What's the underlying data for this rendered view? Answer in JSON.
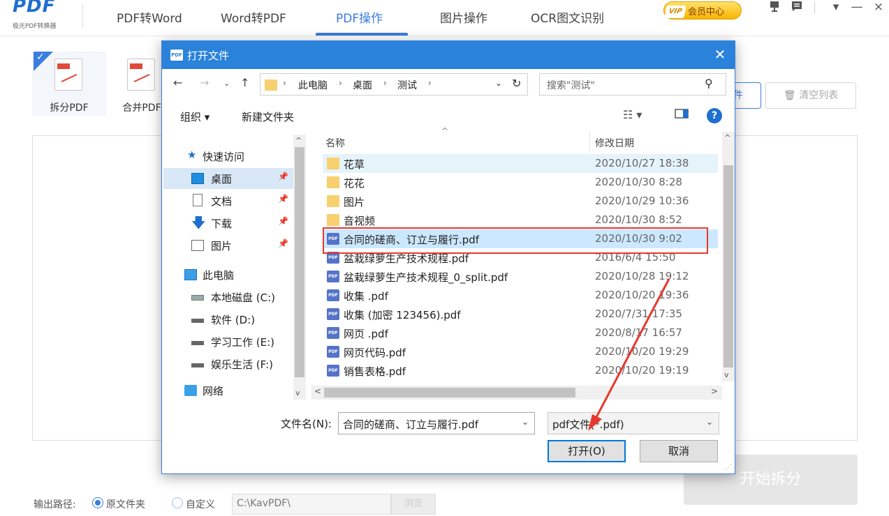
{
  "app": {
    "logo": "PDF",
    "logo_sub": "极光PDF转换器",
    "nav": [
      "PDF转Word",
      "Word转PDF",
      "PDF操作",
      "图片操作",
      "OCR图文识别"
    ],
    "vip_tag": "VIP",
    "vip_label": "会员中心",
    "win_min": "—",
    "win_close": "×",
    "win_menu": "▾"
  },
  "tools": [
    {
      "label": "拆分PDF"
    },
    {
      "label": "合并PDF"
    }
  ],
  "right_buttons": {
    "add": "件",
    "clear": "清空列表",
    "clear_icon": "🗑"
  },
  "start_button": "开始拆分",
  "output": {
    "label": "输出路径:",
    "option_original": "原文件夹",
    "option_custom": "自定义",
    "path": "C:\\KavPDF\\",
    "browse": "浏览"
  },
  "dialog": {
    "title": "打开文件",
    "title_icon": "PDF",
    "close": "✕",
    "address": {
      "crumbs": [
        "此电脑",
        "桌面",
        "测试"
      ],
      "search_placeholder": "搜索\"测试\""
    },
    "commands": {
      "organize": "组织 ▾",
      "new_folder": "新建文件夹"
    },
    "nav_pane": [
      {
        "label": "快速访问",
        "icon": "star-icon",
        "pinned": false
      },
      {
        "label": "桌面",
        "icon": "desktop-icon",
        "pinned": true
      },
      {
        "label": "文档",
        "icon": "document-icon",
        "pinned": true
      },
      {
        "label": "下载",
        "icon": "download-icon",
        "pinned": true
      },
      {
        "label": "图片",
        "icon": "pictures-icon",
        "pinned": true
      },
      {
        "label": "此电脑",
        "icon": "computer-icon",
        "pinned": false
      },
      {
        "label": "本地磁盘 (C:)",
        "icon": "drive-icon",
        "pinned": false
      },
      {
        "label": "软件 (D:)",
        "icon": "drive-icon",
        "pinned": false
      },
      {
        "label": "学习工作 (E:)",
        "icon": "drive-icon",
        "pinned": false
      },
      {
        "label": "娱乐生活 (F:)",
        "icon": "drive-icon",
        "pinned": false
      },
      {
        "label": "网络",
        "icon": "network-icon",
        "pinned": false
      }
    ],
    "columns": {
      "name": "名称",
      "date": "修改日期"
    },
    "files": [
      {
        "name": "花草",
        "date": "2020/10/27 18:38",
        "type": "folder"
      },
      {
        "name": "花花",
        "date": "2020/10/30 8:28",
        "type": "folder"
      },
      {
        "name": "图片",
        "date": "2020/10/29 10:36",
        "type": "folder"
      },
      {
        "name": "音视频",
        "date": "2020/10/30 8:52",
        "type": "folder"
      },
      {
        "name": "合同的磋商、订立与履行.pdf",
        "date": "2020/10/30 9:02",
        "type": "pdf"
      },
      {
        "name": "盆栽绿萝生产技术规程.pdf",
        "date": "2016/6/4 15:50",
        "type": "pdf"
      },
      {
        "name": "盆栽绿萝生产技术规程_0_split.pdf",
        "date": "2020/10/28 19:12",
        "type": "pdf"
      },
      {
        "name": "收集 .pdf",
        "date": "2020/10/20 19:36",
        "type": "pdf"
      },
      {
        "name": "收集 (加密 123456).pdf",
        "date": "2020/7/31 17:35",
        "type": "pdf"
      },
      {
        "name": "网页 .pdf",
        "date": "2020/8/17 16:57",
        "type": "pdf"
      },
      {
        "name": "网页代码.pdf",
        "date": "2020/10/20 19:29",
        "type": "pdf"
      },
      {
        "name": "销售表格.pdf",
        "date": "2020/10/20 19:19",
        "type": "pdf"
      }
    ],
    "filename_label": "文件名(N):",
    "filename_value": "合同的磋商、订立与履行.pdf",
    "filetype_value": "pdf文件(*.pdf)",
    "open_button": "打开(O)",
    "cancel_button": "取消"
  }
}
